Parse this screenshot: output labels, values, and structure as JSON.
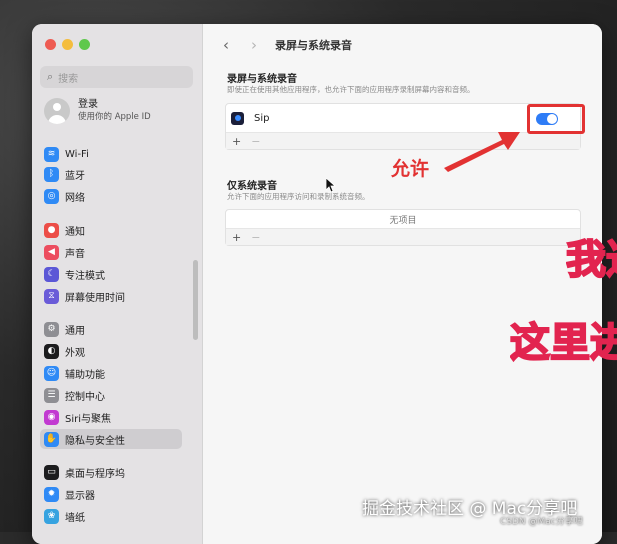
{
  "window": {
    "search_placeholder": "搜索",
    "account": {
      "name": "登录",
      "subtitle": "使用你的 Apple ID"
    },
    "sidebar": {
      "items": [
        {
          "label": "Wi-Fi",
          "icon": "wifi-icon",
          "color": "#2f8af5",
          "glyph": "≋"
        },
        {
          "label": "蓝牙",
          "icon": "bluetooth-icon",
          "color": "#2f8af5",
          "glyph": "ᛒ"
        },
        {
          "label": "网络",
          "icon": "globe-icon",
          "color": "#2f8af5",
          "glyph": "◎"
        },
        {
          "label": "通知",
          "icon": "bell-icon",
          "color": "#ec4d47",
          "glyph": "●"
        },
        {
          "label": "声音",
          "icon": "speaker-icon",
          "color": "#ec4d5f",
          "glyph": "◀"
        },
        {
          "label": "专注模式",
          "icon": "moon-icon",
          "color": "#5b57d6",
          "glyph": "☾"
        },
        {
          "label": "屏幕使用时间",
          "icon": "hourglass-icon",
          "color": "#6a5bd8",
          "glyph": "⧖"
        },
        {
          "label": "通用",
          "icon": "gear-icon",
          "color": "#8e8e93",
          "glyph": "⚙"
        },
        {
          "label": "外观",
          "icon": "appearance-icon",
          "color": "#1c1c1e",
          "glyph": "◐"
        },
        {
          "label": "辅助功能",
          "icon": "accessibility-icon",
          "color": "#2f8af5",
          "glyph": "☺"
        },
        {
          "label": "控制中心",
          "icon": "control-center-icon",
          "color": "#8e8e93",
          "glyph": "☰"
        },
        {
          "label": "Siri与聚焦",
          "icon": "siri-icon",
          "color": "#c23ad1",
          "glyph": "◉"
        },
        {
          "label": "隐私与安全性",
          "icon": "hand-icon",
          "color": "#2f8af5",
          "glyph": "✋"
        },
        {
          "label": "桌面与程序坞",
          "icon": "dock-icon",
          "color": "#1c1c1e",
          "glyph": "▭"
        },
        {
          "label": "显示器",
          "icon": "display-icon",
          "color": "#2f8af5",
          "glyph": "✹"
        },
        {
          "label": "墙纸",
          "icon": "wallpaper-icon",
          "color": "#36a3e0",
          "glyph": "❀"
        }
      ],
      "selected_index": 12
    },
    "header": {
      "back": "‹",
      "forward": "›",
      "title": "录屏与系统录音"
    },
    "screen_recording": {
      "title": "录屏与系统录音",
      "description": "即使正在使用其他应用程序，也允许下面的应用程序录制屏幕内容和音频。",
      "apps": [
        {
          "name": "Sip",
          "enabled": true
        }
      ],
      "add": "+",
      "remove": "−"
    },
    "system_audio": {
      "title": "仅系统录音",
      "description": "允许下面的应用程序访问和录制系统音频。",
      "empty_text": "无项目",
      "add": "+",
      "remove": "−"
    }
  },
  "annotations": {
    "allow_label": "允许",
    "overlay_1": "我达",
    "overlay_2": "这里进"
  },
  "watermark": {
    "main": "掘金技术社区 @ Mac分享吧",
    "small": "CSDN @Mac分享吧"
  },
  "colors": {
    "accent": "#2e7cf6",
    "annotation_red": "#e23232"
  }
}
